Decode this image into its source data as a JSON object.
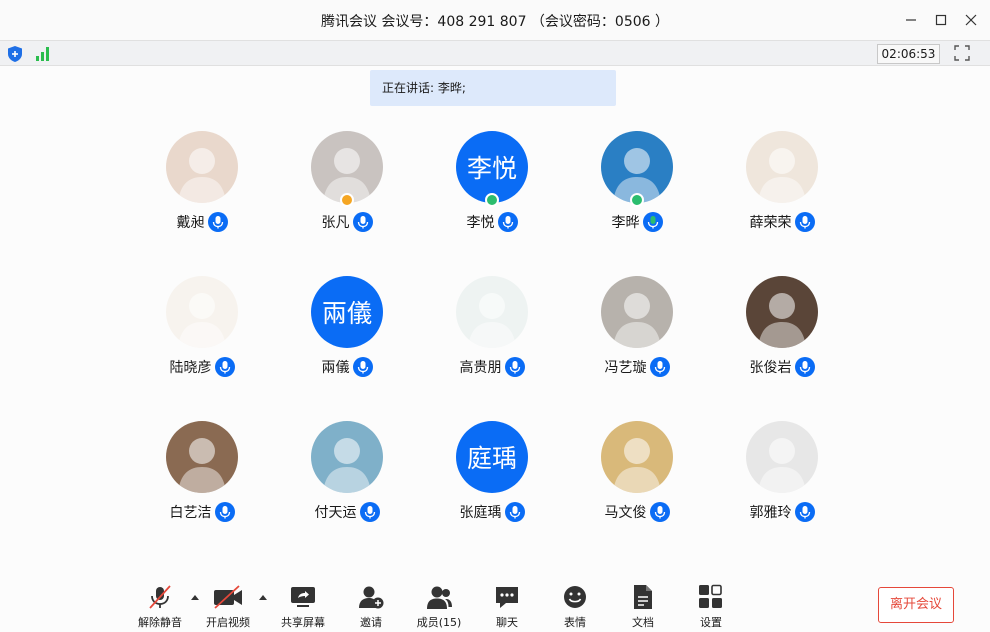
{
  "window": {
    "title": "腾讯会议 会议号：408 291 807 （会议密码：0506 ）",
    "timer": "02:06:53"
  },
  "speaking": "正在讲话: 李晔;",
  "participants": [
    {
      "name": "戴昶",
      "avatar_type": "photo",
      "avatar_color": "#e9d8cc",
      "mic": "muted",
      "badge": ""
    },
    {
      "name": "张凡",
      "avatar_type": "photo",
      "avatar_color": "#c9c3c0",
      "mic": "muted",
      "badge": "orange"
    },
    {
      "name": "李悦",
      "avatar_type": "text",
      "avatar_text": "李悦",
      "mic": "muted",
      "badge": "green"
    },
    {
      "name": "李晔",
      "avatar_type": "photo",
      "avatar_color": "#2a7fc4",
      "mic": "on",
      "badge": "green"
    },
    {
      "name": "薛荣荣",
      "avatar_type": "photo",
      "avatar_color": "#efe6dc",
      "mic": "muted",
      "badge": ""
    },
    {
      "name": "陆晓彦",
      "avatar_type": "photo",
      "avatar_color": "#f7f3ee",
      "mic": "muted",
      "badge": ""
    },
    {
      "name": "兩儀",
      "avatar_type": "text",
      "avatar_text": "兩儀",
      "mic": "muted",
      "badge": ""
    },
    {
      "name": "高贵朋",
      "avatar_type": "photo",
      "avatar_color": "#eef3f2",
      "mic": "muted",
      "badge": ""
    },
    {
      "name": "冯艺璇",
      "avatar_type": "photo",
      "avatar_color": "#b7b2ac",
      "mic": "muted",
      "badge": ""
    },
    {
      "name": "张俊岩",
      "avatar_type": "photo",
      "avatar_color": "#5a4538",
      "mic": "muted",
      "badge": ""
    },
    {
      "name": "白艺洁",
      "avatar_type": "photo",
      "avatar_color": "#8a6a52",
      "mic": "muted",
      "badge": ""
    },
    {
      "name": "付天运",
      "avatar_type": "photo",
      "avatar_color": "#7fb0c9",
      "mic": "muted",
      "badge": ""
    },
    {
      "name": "张庭瑀",
      "avatar_type": "text",
      "avatar_text": "庭瑀",
      "mic": "muted",
      "badge": ""
    },
    {
      "name": "马文俊",
      "avatar_type": "photo",
      "avatar_color": "#d9b97a",
      "mic": "muted",
      "badge": ""
    },
    {
      "name": "郭雅玲",
      "avatar_type": "photo",
      "avatar_color": "#e7e7e7",
      "mic": "muted",
      "badge": ""
    }
  ],
  "toolbar": {
    "unmute": "解除静音",
    "start_video": "开启视频",
    "share_screen": "共享屏幕",
    "invite": "邀请",
    "members": "成员(15)",
    "chat": "聊天",
    "reactions": "表情",
    "docs": "文档",
    "settings": "设置",
    "leave": "离开会议"
  },
  "colors": {
    "accent": "#0a6cf5",
    "leave": "#e5483a",
    "signal": "#2bbd4e"
  }
}
